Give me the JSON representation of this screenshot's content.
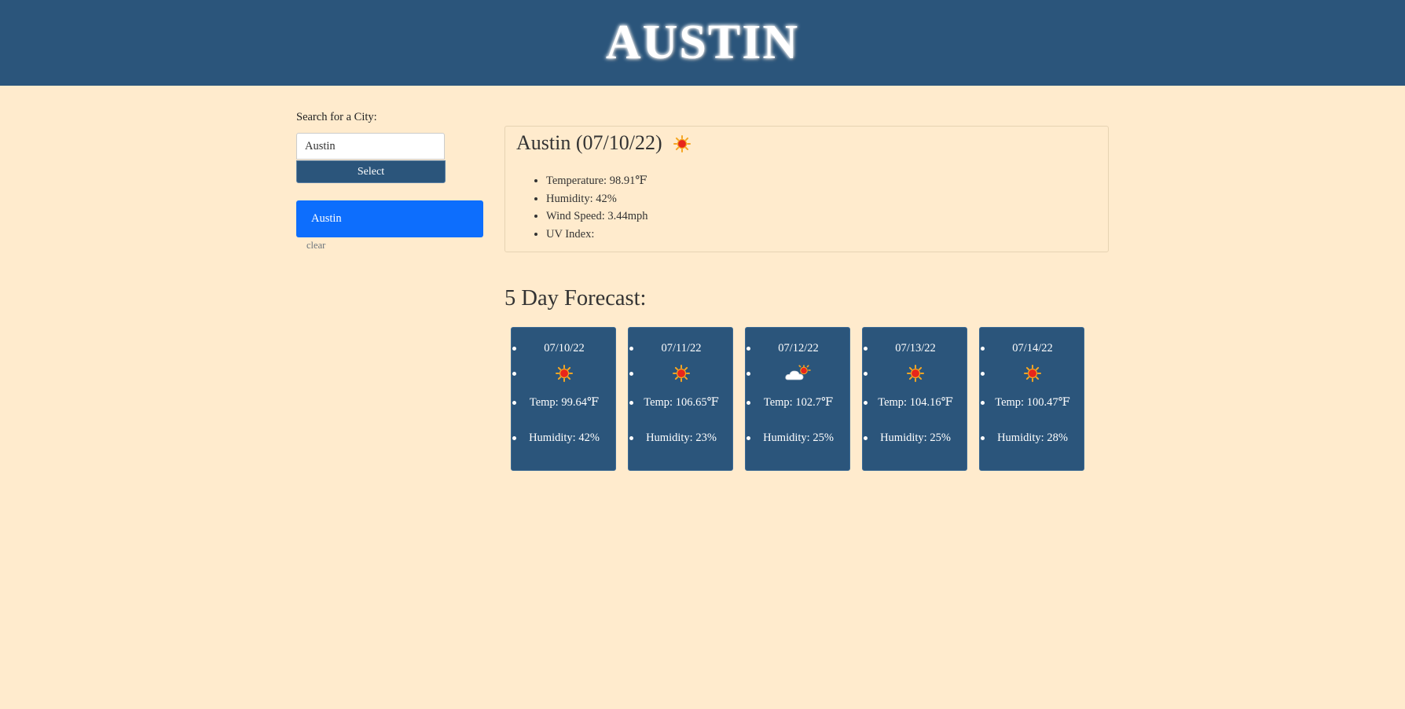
{
  "header": {
    "title": "AUSTIN"
  },
  "search": {
    "label": "Search for a City:",
    "value": "Austin",
    "button_label": "Select"
  },
  "history": {
    "items": [
      "Austin"
    ],
    "clear_label": "clear"
  },
  "current": {
    "title": "Austin (07/10/22)",
    "icon": "sun-icon",
    "temperature": "Temperature: 98.91℉",
    "humidity": "Humidity: 42%",
    "wind": "Wind Speed: 3.44mph",
    "uv": "UV Index:"
  },
  "forecast": {
    "title": "5 Day Forecast:",
    "days": [
      {
        "date": "07/10/22",
        "icon": "sun-icon",
        "temp": "Temp: 99.64℉",
        "humidity": "Humidity: 42%"
      },
      {
        "date": "07/11/22",
        "icon": "sun-icon",
        "temp": "Temp: 106.65℉",
        "humidity": "Humidity: 23%"
      },
      {
        "date": "07/12/22",
        "icon": "partly-cloudy-icon",
        "temp": "Temp: 102.7℉",
        "humidity": "Humidity: 25%"
      },
      {
        "date": "07/13/22",
        "icon": "sun-icon",
        "temp": "Temp: 104.16℉",
        "humidity": "Humidity: 25%"
      },
      {
        "date": "07/14/22",
        "icon": "sun-icon",
        "temp": "Temp: 100.47℉",
        "humidity": "Humidity: 28%"
      }
    ]
  },
  "colors": {
    "page_bg": "#ffebcd",
    "header_bg": "#2b557b",
    "history_active": "#0d6efd"
  }
}
